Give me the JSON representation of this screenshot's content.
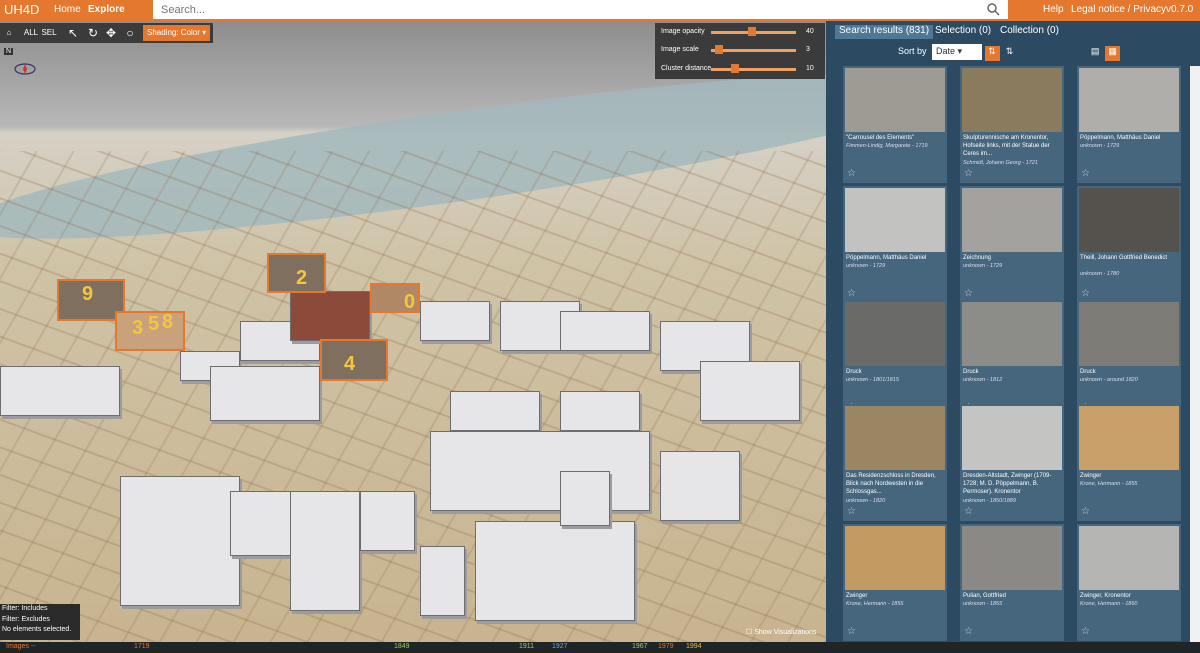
{
  "app": {
    "logo": "UH4D",
    "nav": [
      "Home",
      "Explore"
    ],
    "search_placeholder": "Search...",
    "right_links": [
      "Help",
      "Legal notice / Privacy",
      "v0.7.0"
    ]
  },
  "toolbar": {
    "buttons": [
      "home-icon",
      "zoom-all-icon",
      "zoom-sel-icon",
      "select-icon",
      "orbit-icon",
      "pan-icon",
      "zoom-icon"
    ],
    "zoom_all": "ALL",
    "zoom_sel": "SEL",
    "shading": "Shading: Color"
  },
  "compass": {
    "north": "N"
  },
  "sliders": [
    {
      "label": "Image opacity",
      "value": "40",
      "fraction": 0.44
    },
    {
      "label": "Image scale",
      "value": "3",
      "fraction": 0.05
    },
    {
      "label": "Cluster distance",
      "value": "10",
      "fraction": 0.13
    }
  ],
  "clusters": [
    "9",
    "2",
    "0",
    "3",
    "5",
    "8",
    "4"
  ],
  "filters": {
    "includes": "Filter: Includes",
    "excludes": "Filter: Excludes",
    "status": "No elements selected."
  },
  "show_viz": "Show Visualizations",
  "timeline": {
    "label": "Images --",
    "years": [
      "1719",
      "1849",
      "1911",
      "1927",
      "1967",
      "1979",
      "1994"
    ]
  },
  "panel": {
    "tabs": [
      "Search results (831)",
      "Selection (0)",
      "Collection (0)"
    ],
    "sort_label": "Sort by",
    "sort_value": "Date"
  },
  "cards": [
    {
      "title": "\"Carrousel des Elements\"",
      "author": "Fimmen-Lindig, Margarete - 1719"
    },
    {
      "title": "Skulpturennische am Kronentor, Hofseite links, mit der Statue der Ceres im...",
      "author": "Schmidt, Johann Georg - 1721"
    },
    {
      "title": "Pöppelmann, Matthäus Daniel",
      "author": "unknown - 1729"
    },
    {
      "title": "Pöppelmann, Matthäus Daniel",
      "author": "unknown - 1729"
    },
    {
      "title": "Zeichnung",
      "author": "unknown - 1729"
    },
    {
      "title": "Theill, Johann Gottfried Benedict",
      "author": "unknown - 1780"
    },
    {
      "title": "Druck",
      "author": "unknown - 1801/1815"
    },
    {
      "title": "Druck",
      "author": "unknown - 1812"
    },
    {
      "title": "Druck",
      "author": "unknown - around 1820"
    },
    {
      "title": "Das Residenzschloss in Dresden, Blick nach Nordwesten in die Schlossgas...",
      "author": "unknown - 1820"
    },
    {
      "title": "Dresden-Altstadt, Zwinger (1709-1728; M. D. Pöppelmann, B. Permoser). Kronentor",
      "author": "unknown - 1850/1889"
    },
    {
      "title": "Zwinger",
      "author": "Krone, Hermann - 1855"
    },
    {
      "title": "Zwinger",
      "author": "Krone, Hermann - 1855"
    },
    {
      "title": "Pulian, Gottfried",
      "author": "unknown - 1855"
    },
    {
      "title": "Zwinger, Kronentor",
      "author": "Krone, Hermann - 1860"
    }
  ]
}
